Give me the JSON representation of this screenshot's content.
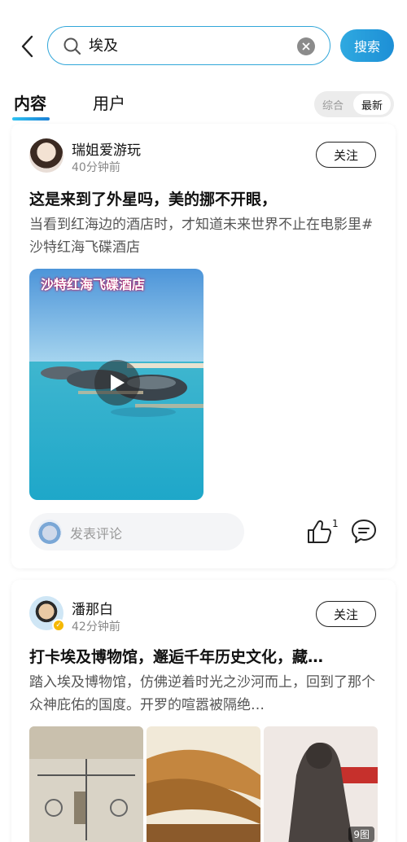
{
  "search": {
    "query": "埃及",
    "button_label": "搜索"
  },
  "tabs": [
    {
      "label": "内容",
      "active": true
    },
    {
      "label": "用户",
      "active": false
    }
  ],
  "sort": {
    "options": [
      "综合",
      "最新"
    ],
    "selected": "最新"
  },
  "posts": [
    {
      "username": "瑞姐爱游玩",
      "time": "40分钟前",
      "follow_label": "关注",
      "title": "这是来到了外星吗，美的挪不开眼，",
      "body": "当看到红海边的酒店时，才知道未来世界不止在电影里#沙特红海飞碟酒店",
      "video_caption": "沙特红海飞碟酒店",
      "comment_placeholder": "发表评论",
      "like_count": "1"
    },
    {
      "username": "潘那白",
      "time": "42分钟前",
      "follow_label": "关注",
      "title": "打卡埃及博物馆，邂逅千年历史文化，藏…",
      "body": "踏入埃及博物馆，仿佛逆着时光之沙河而上，回到了那个众神庇佑的国度。开罗的喧嚣被隔绝…",
      "image_count": "9图"
    }
  ],
  "colors": {
    "accent": "#2fa9e0",
    "search_border": "#31a6d9"
  }
}
